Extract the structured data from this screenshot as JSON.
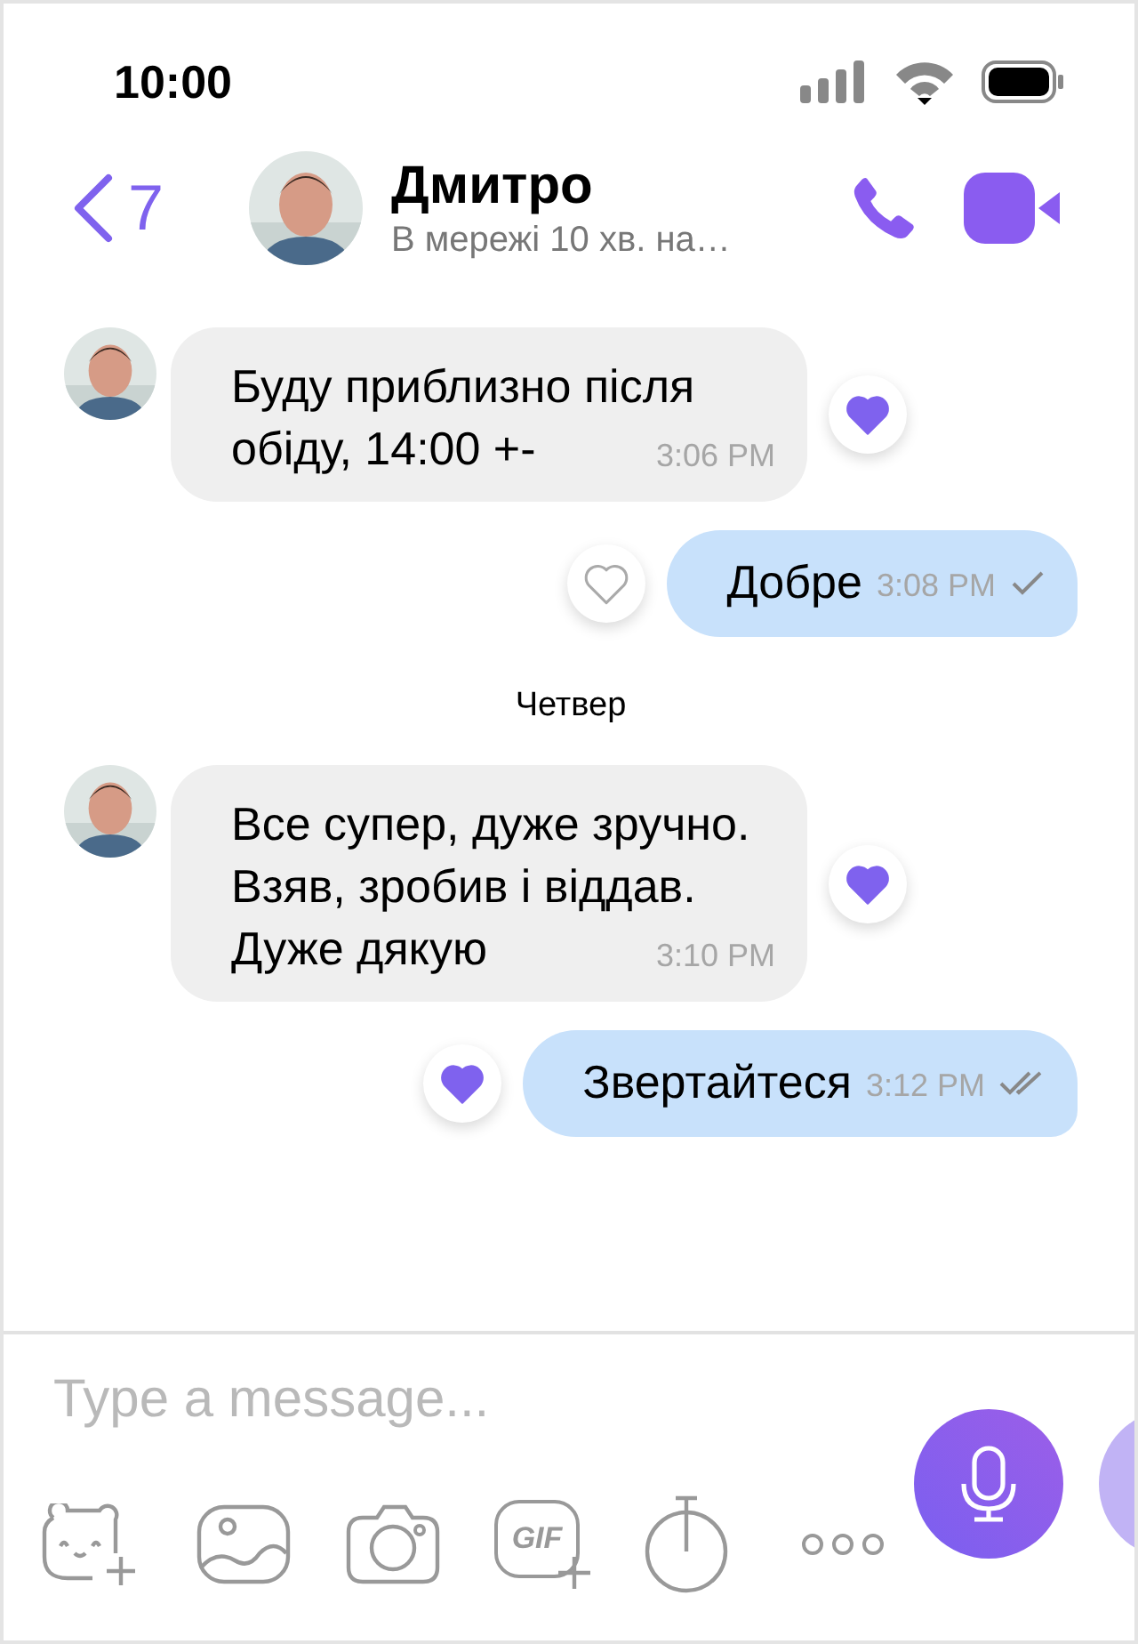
{
  "status_bar": {
    "time": "10:00"
  },
  "header": {
    "back_count": "7",
    "name": "Дмитро",
    "status": "В мережі 10 хв. на…"
  },
  "messages": [
    {
      "kind": "incoming",
      "text": "Буду приблизно після обіду, 14:00 +-",
      "time": "3:06 PM",
      "liked": true
    },
    {
      "kind": "outgoing",
      "text": "Добре",
      "time": "3:08 PM",
      "liked": false,
      "delivered": false
    },
    {
      "kind": "date",
      "text": "Четвер"
    },
    {
      "kind": "incoming",
      "text": "Все супер, дуже зручно. Взяв, зробив і віддав. Дуже дякую",
      "time": "3:10 PM",
      "liked": true
    },
    {
      "kind": "outgoing",
      "text": "Звертайтеся",
      "time": "3:12 PM",
      "liked": true,
      "delivered": true
    }
  ],
  "composer": {
    "placeholder": "Type a message...",
    "gif_label": "GIF"
  }
}
